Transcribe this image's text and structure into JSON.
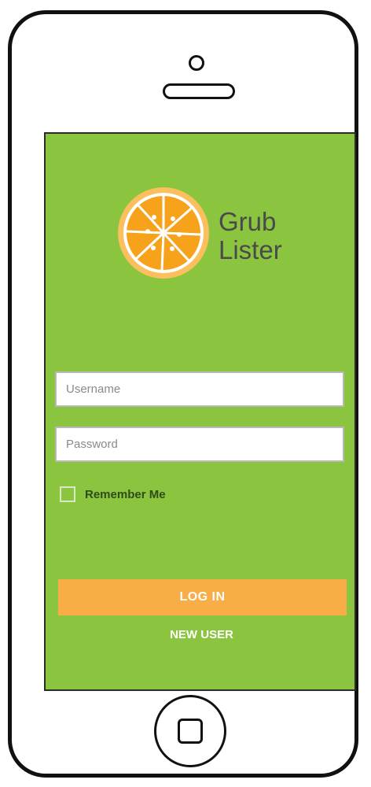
{
  "brand": {
    "name_line1": "Grub",
    "name_line2": "Lister",
    "logo_icon": "orange-slice-icon"
  },
  "form": {
    "username_placeholder": "Username",
    "password_placeholder": "Password",
    "remember_label": "Remember Me",
    "remember_checked": false
  },
  "actions": {
    "login_label": "LOG IN",
    "new_user_label": "NEW USER"
  },
  "colors": {
    "screen_background": "#8bc43f",
    "login_button": "#f9ad46",
    "logo_orange": "#f7a21b",
    "logo_rind": "#fbbf5b",
    "text_dark": "#4a4a4a"
  }
}
